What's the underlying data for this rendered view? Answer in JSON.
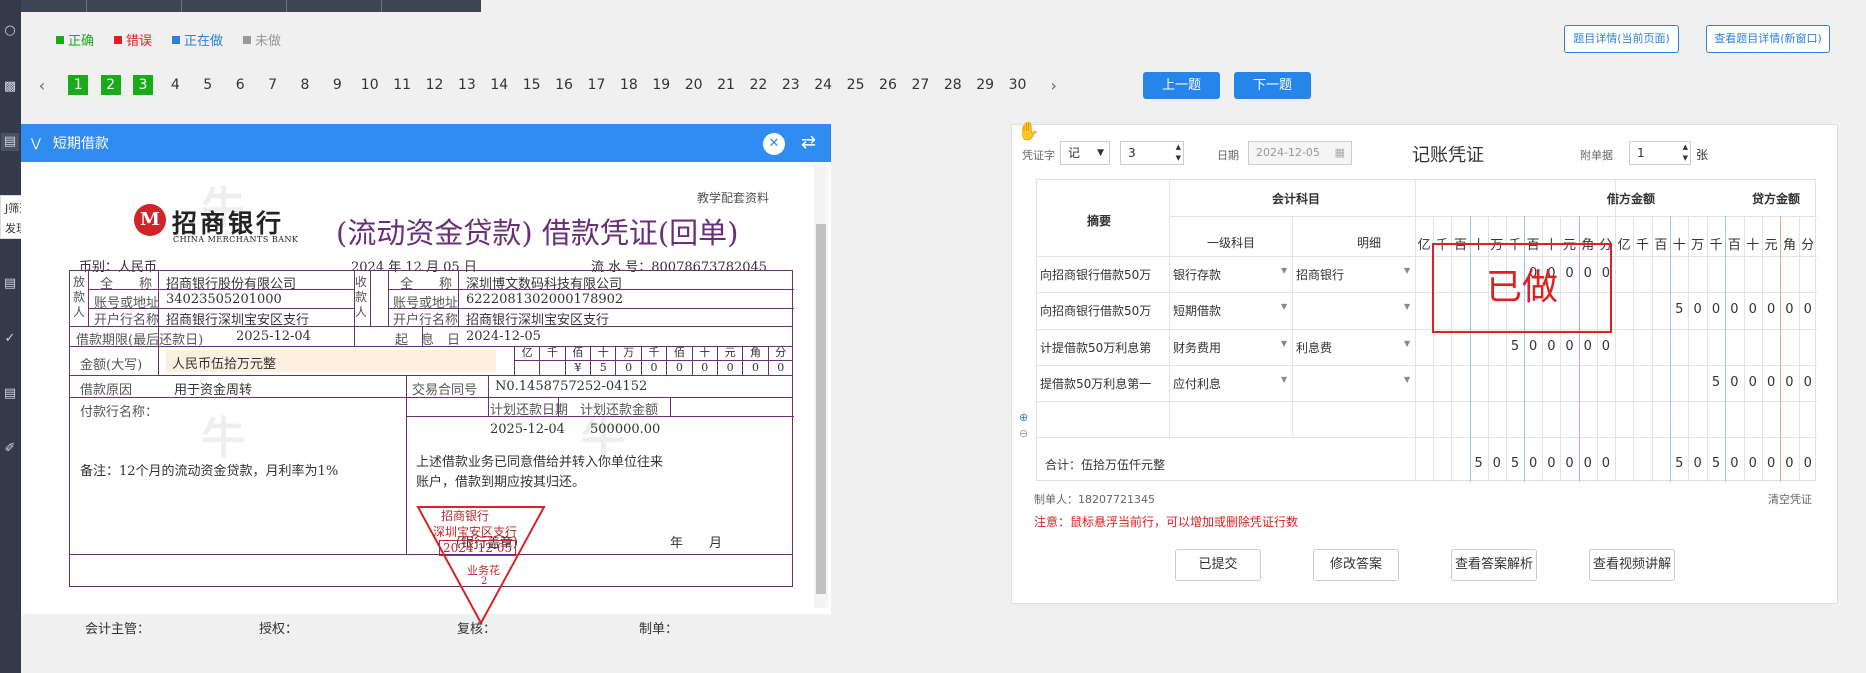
{
  "legend": [
    {
      "label": "正确",
      "color": "#1aaa1a"
    },
    {
      "label": "错误",
      "color": "#e02020"
    },
    {
      "label": "正在做",
      "color": "#2f7fe0"
    },
    {
      "label": "未做",
      "color": "#999999"
    }
  ],
  "top_buttons": {
    "detail_current": "题目详情(当前页面)",
    "detail_new": "查看题目详情(新窗口)"
  },
  "question_nav": {
    "done": [
      "1",
      "2",
      "3"
    ],
    "numbers": [
      "4",
      "5",
      "6",
      "7",
      "8",
      "9",
      "10",
      "11",
      "12",
      "13",
      "14",
      "15",
      "16",
      "17",
      "18",
      "19",
      "20",
      "21",
      "22",
      "23",
      "24",
      "25",
      "26",
      "27",
      "28",
      "29",
      "30"
    ],
    "prev": "上一题",
    "next": "下一题"
  },
  "side_tip": {
    "line1": "J筛选",
    "line2": "发现AI好用工具"
  },
  "left_panel": {
    "title": "短期借款",
    "doc": {
      "bank_cn": "招商银行",
      "bank_en": "CHINA MERCHANTS BANK",
      "title": "(流动资金贷款) 借款凭证(回单)",
      "watermark": "教学配套资料",
      "currency": "币别：人民币",
      "date": "2024 年 12 月 05 日",
      "serial": "流 水 号：80078673782045",
      "payer_label": "放款人",
      "payee_label": "收款人",
      "name_label": "全　　称",
      "account_label": "账号或地址",
      "bank_label": "开户行名称",
      "payer_name": "招商银行股份有限公司",
      "payer_account": "34023505201000",
      "payer_bank": "招商银行深圳宝安区支行",
      "payee_name": "深圳博文数码科技有限公司",
      "payee_account": "6222081302000178902",
      "payee_bank": "招商银行深圳宝安区支行",
      "term_label": "借款期限(最后还款日)",
      "term_value": "2025-12-04",
      "start_label": "起　息　日",
      "start_value": "2024-12-05",
      "amount_label": "金额(大写)",
      "amount_value": "人民币伍拾万元整",
      "digit_units": [
        "亿",
        "千",
        "佰",
        "十",
        "万",
        "千",
        "佰",
        "十",
        "元",
        "角",
        "分"
      ],
      "digit_values": [
        "",
        "",
        "¥",
        "5",
        "0",
        "0",
        "0",
        "0",
        "0",
        "0",
        "0"
      ],
      "reason_label": "借款原因",
      "reason_value": "用于资金周转",
      "contract_label": "交易合同号",
      "contract_value": "N0.1458757252-04152",
      "pay_bank_label": "付款行名称：",
      "plan_date_label": "计划还款日期",
      "plan_amount_label": "计划还款金额",
      "plan_date": "2025-12-04",
      "plan_amount": "500000.00",
      "note": "备注：12个月的流动资金贷款，月利率为1%",
      "statement1": "上述借款业务已同意借给并转入你单位往来",
      "statement2": "账户，借款到期应按其归还。",
      "bank_stamp": "（银行盖章）",
      "year_month": "年　　月",
      "stamp_line1": "招商银行",
      "stamp_line2": "深圳宝安区支行",
      "stamp_date": "2024-12-05",
      "stamp_line3": "业务花",
      "stamp_line4": "2",
      "sig_accountant": "会计主管：",
      "sig_auth": "授权：",
      "sig_review": "复核：",
      "sig_maker": "制单："
    }
  },
  "right_panel": {
    "voucher_word_label": "凭证字",
    "voucher_word": "记",
    "voucher_no": "3",
    "date_label": "日期",
    "date_value": "2024-12-05",
    "title": "记账凭证",
    "attach_label": "附单据",
    "attach_value": "1",
    "attach_unit": "张",
    "col_summary": "摘要",
    "col_subject": "会计科目",
    "col_level1": "一级科目",
    "col_detail": "明细",
    "col_debit": "借方金额",
    "col_credit": "贷方金额",
    "digit_units": [
      "亿",
      "千",
      "百",
      "十",
      "万",
      "千",
      "百",
      "十",
      "元",
      "角",
      "分"
    ],
    "rows": [
      {
        "summary": "向招商银行借款50万",
        "level1": "银行存款",
        "detail": "招商银行",
        "debit": [
          "",
          "",
          "",
          "",
          "",
          "",
          "0",
          "0",
          "0",
          "0",
          "0"
        ],
        "credit": [
          "",
          "",
          "",
          "",
          "",
          "",
          "",
          "",
          "",
          "",
          ""
        ]
      },
      {
        "summary": "向招商银行借款50万",
        "level1": "短期借款",
        "detail": "",
        "debit": [
          "",
          "",
          "",
          "",
          "",
          "",
          "",
          "",
          "",
          "",
          ""
        ],
        "credit": [
          "",
          "",
          "",
          "5",
          "0",
          "0",
          "0",
          "0",
          "0",
          "0",
          "0"
        ]
      },
      {
        "summary": "计提借款50万利息第",
        "level1": "财务费用",
        "detail": "利息费",
        "debit": [
          "",
          "",
          "",
          "",
          "",
          "5",
          "0",
          "0",
          "0",
          "0",
          "0"
        ],
        "credit": [
          "",
          "",
          "",
          "",
          "",
          "",
          "",
          "",
          "",
          "",
          ""
        ]
      },
      {
        "summary": "提借款50万利息第一",
        "level1": "应付利息",
        "detail": "",
        "debit": [
          "",
          "",
          "",
          "",
          "",
          "",
          "",
          "",
          "",
          "",
          ""
        ],
        "credit": [
          "",
          "",
          "",
          "",
          "",
          "5",
          "0",
          "0",
          "0",
          "0",
          "0"
        ]
      }
    ],
    "total_label": "合计：伍拾万伍仟元整",
    "total_debit": [
      "",
      "",
      "",
      "5",
      "0",
      "5",
      "0",
      "0",
      "0",
      "0",
      "0"
    ],
    "total_credit": [
      "",
      "",
      "",
      "5",
      "0",
      "5",
      "0",
      "0",
      "0",
      "0",
      "0"
    ],
    "maker": "制单人：18207721345",
    "clear": "清空凭证",
    "notice": "注意：鼠标悬浮当前行，可以增加或删除凭证行数",
    "stamp": "已做",
    "buttons": [
      "已提交",
      "修改答案",
      "查看答案解析",
      "查看视频讲解"
    ]
  }
}
